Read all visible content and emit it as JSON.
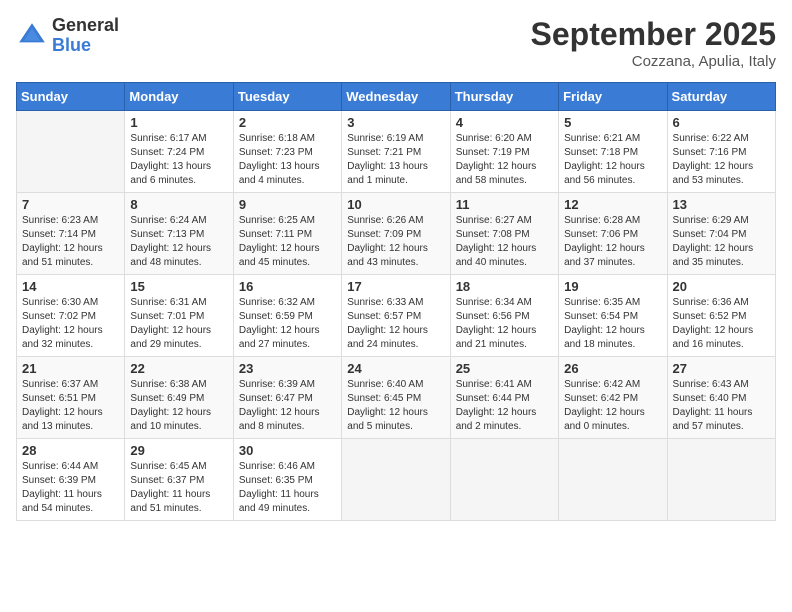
{
  "logo": {
    "general": "General",
    "blue": "Blue"
  },
  "title": "September 2025",
  "location": "Cozzana, Apulia, Italy",
  "weekdays": [
    "Sunday",
    "Monday",
    "Tuesday",
    "Wednesday",
    "Thursday",
    "Friday",
    "Saturday"
  ],
  "weeks": [
    [
      {
        "day": "",
        "info": ""
      },
      {
        "day": "1",
        "info": "Sunrise: 6:17 AM\nSunset: 7:24 PM\nDaylight: 13 hours\nand 6 minutes."
      },
      {
        "day": "2",
        "info": "Sunrise: 6:18 AM\nSunset: 7:23 PM\nDaylight: 13 hours\nand 4 minutes."
      },
      {
        "day": "3",
        "info": "Sunrise: 6:19 AM\nSunset: 7:21 PM\nDaylight: 13 hours\nand 1 minute."
      },
      {
        "day": "4",
        "info": "Sunrise: 6:20 AM\nSunset: 7:19 PM\nDaylight: 12 hours\nand 58 minutes."
      },
      {
        "day": "5",
        "info": "Sunrise: 6:21 AM\nSunset: 7:18 PM\nDaylight: 12 hours\nand 56 minutes."
      },
      {
        "day": "6",
        "info": "Sunrise: 6:22 AM\nSunset: 7:16 PM\nDaylight: 12 hours\nand 53 minutes."
      }
    ],
    [
      {
        "day": "7",
        "info": "Sunrise: 6:23 AM\nSunset: 7:14 PM\nDaylight: 12 hours\nand 51 minutes."
      },
      {
        "day": "8",
        "info": "Sunrise: 6:24 AM\nSunset: 7:13 PM\nDaylight: 12 hours\nand 48 minutes."
      },
      {
        "day": "9",
        "info": "Sunrise: 6:25 AM\nSunset: 7:11 PM\nDaylight: 12 hours\nand 45 minutes."
      },
      {
        "day": "10",
        "info": "Sunrise: 6:26 AM\nSunset: 7:09 PM\nDaylight: 12 hours\nand 43 minutes."
      },
      {
        "day": "11",
        "info": "Sunrise: 6:27 AM\nSunset: 7:08 PM\nDaylight: 12 hours\nand 40 minutes."
      },
      {
        "day": "12",
        "info": "Sunrise: 6:28 AM\nSunset: 7:06 PM\nDaylight: 12 hours\nand 37 minutes."
      },
      {
        "day": "13",
        "info": "Sunrise: 6:29 AM\nSunset: 7:04 PM\nDaylight: 12 hours\nand 35 minutes."
      }
    ],
    [
      {
        "day": "14",
        "info": "Sunrise: 6:30 AM\nSunset: 7:02 PM\nDaylight: 12 hours\nand 32 minutes."
      },
      {
        "day": "15",
        "info": "Sunrise: 6:31 AM\nSunset: 7:01 PM\nDaylight: 12 hours\nand 29 minutes."
      },
      {
        "day": "16",
        "info": "Sunrise: 6:32 AM\nSunset: 6:59 PM\nDaylight: 12 hours\nand 27 minutes."
      },
      {
        "day": "17",
        "info": "Sunrise: 6:33 AM\nSunset: 6:57 PM\nDaylight: 12 hours\nand 24 minutes."
      },
      {
        "day": "18",
        "info": "Sunrise: 6:34 AM\nSunset: 6:56 PM\nDaylight: 12 hours\nand 21 minutes."
      },
      {
        "day": "19",
        "info": "Sunrise: 6:35 AM\nSunset: 6:54 PM\nDaylight: 12 hours\nand 18 minutes."
      },
      {
        "day": "20",
        "info": "Sunrise: 6:36 AM\nSunset: 6:52 PM\nDaylight: 12 hours\nand 16 minutes."
      }
    ],
    [
      {
        "day": "21",
        "info": "Sunrise: 6:37 AM\nSunset: 6:51 PM\nDaylight: 12 hours\nand 13 minutes."
      },
      {
        "day": "22",
        "info": "Sunrise: 6:38 AM\nSunset: 6:49 PM\nDaylight: 12 hours\nand 10 minutes."
      },
      {
        "day": "23",
        "info": "Sunrise: 6:39 AM\nSunset: 6:47 PM\nDaylight: 12 hours\nand 8 minutes."
      },
      {
        "day": "24",
        "info": "Sunrise: 6:40 AM\nSunset: 6:45 PM\nDaylight: 12 hours\nand 5 minutes."
      },
      {
        "day": "25",
        "info": "Sunrise: 6:41 AM\nSunset: 6:44 PM\nDaylight: 12 hours\nand 2 minutes."
      },
      {
        "day": "26",
        "info": "Sunrise: 6:42 AM\nSunset: 6:42 PM\nDaylight: 12 hours\nand 0 minutes."
      },
      {
        "day": "27",
        "info": "Sunrise: 6:43 AM\nSunset: 6:40 PM\nDaylight: 11 hours\nand 57 minutes."
      }
    ],
    [
      {
        "day": "28",
        "info": "Sunrise: 6:44 AM\nSunset: 6:39 PM\nDaylight: 11 hours\nand 54 minutes."
      },
      {
        "day": "29",
        "info": "Sunrise: 6:45 AM\nSunset: 6:37 PM\nDaylight: 11 hours\nand 51 minutes."
      },
      {
        "day": "30",
        "info": "Sunrise: 6:46 AM\nSunset: 6:35 PM\nDaylight: 11 hours\nand 49 minutes."
      },
      {
        "day": "",
        "info": ""
      },
      {
        "day": "",
        "info": ""
      },
      {
        "day": "",
        "info": ""
      },
      {
        "day": "",
        "info": ""
      }
    ]
  ]
}
